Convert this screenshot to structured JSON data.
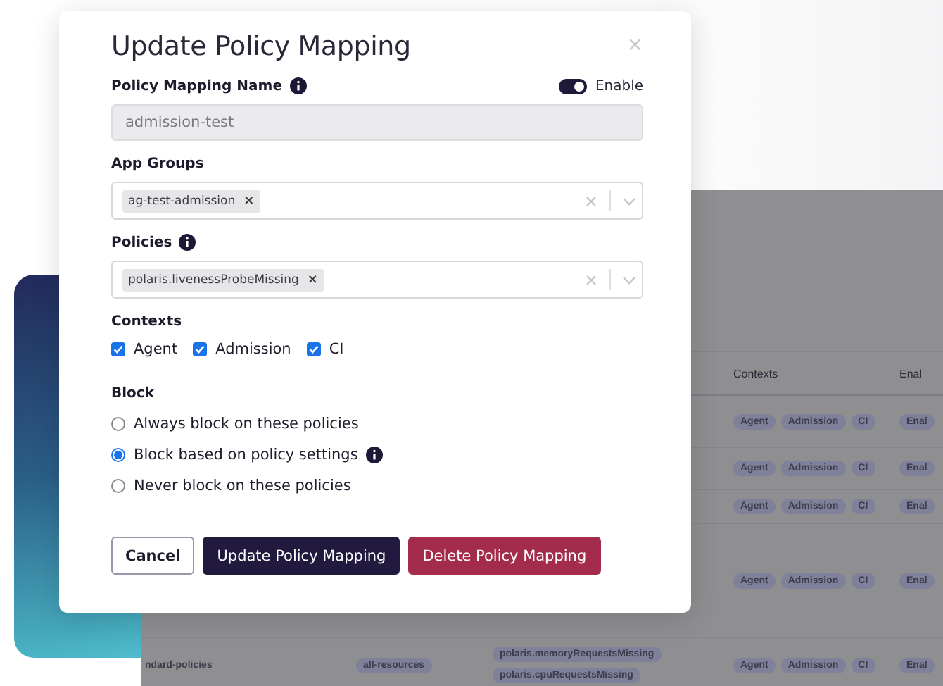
{
  "background_table": {
    "columns": [
      {
        "label": "Contexts"
      },
      {
        "label": "Enal"
      }
    ],
    "rows": [
      {
        "contexts": [
          "Agent",
          "Admission",
          "CI"
        ],
        "enabled": "Enal"
      },
      {
        "contexts": [
          "Agent",
          "Admission",
          "CI"
        ],
        "enabled": "Enal"
      },
      {
        "contexts": [
          "Agent",
          "Admission",
          "CI"
        ],
        "enabled": "Enal"
      },
      {
        "contexts": [
          "Agent",
          "Admission",
          "CI"
        ],
        "enabled": "Enal"
      },
      {
        "name": "ndard-policies",
        "app_group": "all-resources",
        "policies": [
          "polaris.memoryRequestsMissing",
          "polaris.cpuRequestsMissing"
        ],
        "contexts": [
          "Agent",
          "Admission",
          "CI"
        ],
        "enabled": "Enal"
      }
    ]
  },
  "modal": {
    "title": "Update Policy Mapping",
    "close": "×",
    "name_label": "Policy Mapping Name",
    "enable": {
      "label": "Enable",
      "on": true
    },
    "name_field": {
      "value": "admission-test"
    },
    "app_groups": {
      "label": "App Groups",
      "info": false,
      "tags": [
        {
          "label": "ag-test-admission",
          "remove": "×"
        }
      ]
    },
    "policies": {
      "label": "Policies",
      "info": true,
      "tags": [
        {
          "label": "polaris.livenessProbeMissing",
          "remove": "×"
        }
      ]
    },
    "contexts": {
      "label": "Contexts",
      "options": [
        {
          "label": "Agent",
          "checked": true
        },
        {
          "label": "Admission",
          "checked": true
        },
        {
          "label": "CI",
          "checked": true
        }
      ]
    },
    "block": {
      "label": "Block",
      "options": [
        {
          "label": "Always block on these policies",
          "selected": false,
          "info": false
        },
        {
          "label": "Block based on policy settings",
          "selected": true,
          "info": true
        },
        {
          "label": "Never block on these policies",
          "selected": false,
          "info": false
        }
      ]
    },
    "buttons": [
      {
        "label": "Cancel",
        "kind": "secondary"
      },
      {
        "label": "Update Policy Mapping",
        "kind": "primary"
      },
      {
        "label": "Delete Policy Mapping",
        "kind": "danger"
      }
    ]
  }
}
